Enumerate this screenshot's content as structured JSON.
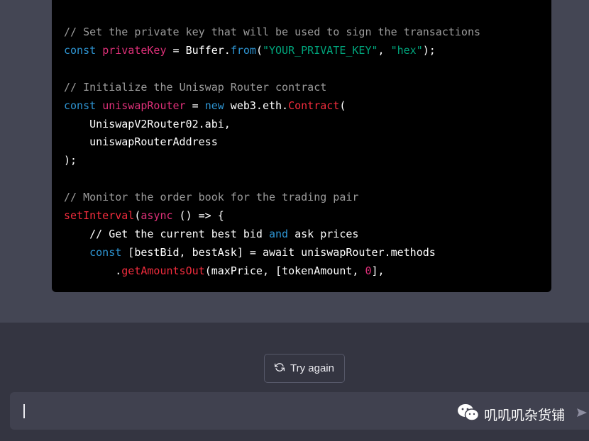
{
  "code": {
    "lines": [
      [
        {
          "t": "// Set the private key that will be used to sign the transactions",
          "c": "cm"
        }
      ],
      [
        {
          "t": "const",
          "c": "kw"
        },
        {
          "t": " ",
          "c": "txt"
        },
        {
          "t": "privateKey",
          "c": "var"
        },
        {
          "t": " = Buffer.",
          "c": "txt"
        },
        {
          "t": "from",
          "c": "kw"
        },
        {
          "t": "(",
          "c": "txt"
        },
        {
          "t": "\"YOUR_PRIVATE_KEY\"",
          "c": "str"
        },
        {
          "t": ", ",
          "c": "txt"
        },
        {
          "t": "\"hex\"",
          "c": "str"
        },
        {
          "t": ");",
          "c": "txt"
        }
      ],
      [],
      [
        {
          "t": "// Initialize the Uniswap Router contract",
          "c": "cm"
        }
      ],
      [
        {
          "t": "const",
          "c": "kw"
        },
        {
          "t": " ",
          "c": "txt"
        },
        {
          "t": "uniswapRouter",
          "c": "var"
        },
        {
          "t": " = ",
          "c": "txt"
        },
        {
          "t": "new",
          "c": "kw"
        },
        {
          "t": " web3.eth.",
          "c": "txt"
        },
        {
          "t": "Contract",
          "c": "fn"
        },
        {
          "t": "(",
          "c": "txt"
        }
      ],
      [
        {
          "t": "    UniswapV2Router02.abi,",
          "c": "txt"
        }
      ],
      [
        {
          "t": "    uniswapRouterAddress",
          "c": "txt"
        }
      ],
      [
        {
          "t": ");",
          "c": "txt"
        }
      ],
      [],
      [
        {
          "t": "// Monitor the order book for the trading pair",
          "c": "cm"
        }
      ],
      [
        {
          "t": "setInterval",
          "c": "fn"
        },
        {
          "t": "(",
          "c": "txt"
        },
        {
          "t": "async",
          "c": "var"
        },
        {
          "t": " () => {",
          "c": "txt"
        }
      ],
      [
        {
          "t": "    // Get the current best bid ",
          "c": "txt"
        },
        {
          "t": "and",
          "c": "kw"
        },
        {
          "t": " ask prices",
          "c": "txt"
        }
      ],
      [
        {
          "t": "    ",
          "c": "txt"
        },
        {
          "t": "const",
          "c": "kw"
        },
        {
          "t": " [bestBid, bestAsk] = await uniswapRouter.methods",
          "c": "txt"
        }
      ],
      [
        {
          "t": "        .",
          "c": "txt"
        },
        {
          "t": "getAmountsOut",
          "c": "fn"
        },
        {
          "t": "(maxPrice, [tokenAmount, ",
          "c": "txt"
        },
        {
          "t": "0",
          "c": "var"
        },
        {
          "t": "],",
          "c": "txt"
        }
      ]
    ]
  },
  "try_again": {
    "label": "Try again",
    "icon": "refresh-icon"
  },
  "composer": {
    "placeholder": "",
    "send_icon": "send-icon"
  },
  "watermark": {
    "text": "叽叽叽杂货铺",
    "icon": "wechat-icon"
  },
  "colors": {
    "keyword": "#2e95d3",
    "variable": "#df3079",
    "string": "#00a67d",
    "function": "#f22c3d",
    "comment": "#9b9b9b"
  }
}
